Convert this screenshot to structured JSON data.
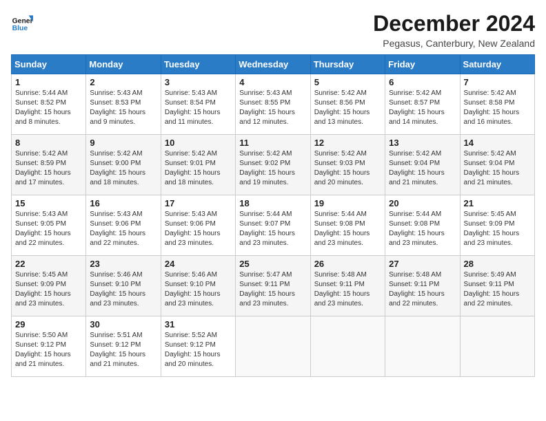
{
  "logo": {
    "line1": "General",
    "line2": "Blue"
  },
  "title": "December 2024",
  "location": "Pegasus, Canterbury, New Zealand",
  "weekdays": [
    "Sunday",
    "Monday",
    "Tuesday",
    "Wednesday",
    "Thursday",
    "Friday",
    "Saturday"
  ],
  "weeks": [
    [
      {
        "day": 1,
        "sunrise": "5:44 AM",
        "sunset": "8:52 PM",
        "daylight": "15 hours and 8 minutes."
      },
      {
        "day": 2,
        "sunrise": "5:43 AM",
        "sunset": "8:53 PM",
        "daylight": "15 hours and 9 minutes."
      },
      {
        "day": 3,
        "sunrise": "5:43 AM",
        "sunset": "8:54 PM",
        "daylight": "15 hours and 11 minutes."
      },
      {
        "day": 4,
        "sunrise": "5:43 AM",
        "sunset": "8:55 PM",
        "daylight": "15 hours and 12 minutes."
      },
      {
        "day": 5,
        "sunrise": "5:42 AM",
        "sunset": "8:56 PM",
        "daylight": "15 hours and 13 minutes."
      },
      {
        "day": 6,
        "sunrise": "5:42 AM",
        "sunset": "8:57 PM",
        "daylight": "15 hours and 14 minutes."
      },
      {
        "day": 7,
        "sunrise": "5:42 AM",
        "sunset": "8:58 PM",
        "daylight": "15 hours and 16 minutes."
      }
    ],
    [
      {
        "day": 8,
        "sunrise": "5:42 AM",
        "sunset": "8:59 PM",
        "daylight": "15 hours and 17 minutes."
      },
      {
        "day": 9,
        "sunrise": "5:42 AM",
        "sunset": "9:00 PM",
        "daylight": "15 hours and 18 minutes."
      },
      {
        "day": 10,
        "sunrise": "5:42 AM",
        "sunset": "9:01 PM",
        "daylight": "15 hours and 18 minutes."
      },
      {
        "day": 11,
        "sunrise": "5:42 AM",
        "sunset": "9:02 PM",
        "daylight": "15 hours and 19 minutes."
      },
      {
        "day": 12,
        "sunrise": "5:42 AM",
        "sunset": "9:03 PM",
        "daylight": "15 hours and 20 minutes."
      },
      {
        "day": 13,
        "sunrise": "5:42 AM",
        "sunset": "9:04 PM",
        "daylight": "15 hours and 21 minutes."
      },
      {
        "day": 14,
        "sunrise": "5:42 AM",
        "sunset": "9:04 PM",
        "daylight": "15 hours and 21 minutes."
      }
    ],
    [
      {
        "day": 15,
        "sunrise": "5:43 AM",
        "sunset": "9:05 PM",
        "daylight": "15 hours and 22 minutes."
      },
      {
        "day": 16,
        "sunrise": "5:43 AM",
        "sunset": "9:06 PM",
        "daylight": "15 hours and 22 minutes."
      },
      {
        "day": 17,
        "sunrise": "5:43 AM",
        "sunset": "9:06 PM",
        "daylight": "15 hours and 23 minutes."
      },
      {
        "day": 18,
        "sunrise": "5:44 AM",
        "sunset": "9:07 PM",
        "daylight": "15 hours and 23 minutes."
      },
      {
        "day": 19,
        "sunrise": "5:44 AM",
        "sunset": "9:08 PM",
        "daylight": "15 hours and 23 minutes."
      },
      {
        "day": 20,
        "sunrise": "5:44 AM",
        "sunset": "9:08 PM",
        "daylight": "15 hours and 23 minutes."
      },
      {
        "day": 21,
        "sunrise": "5:45 AM",
        "sunset": "9:09 PM",
        "daylight": "15 hours and 23 minutes."
      }
    ],
    [
      {
        "day": 22,
        "sunrise": "5:45 AM",
        "sunset": "9:09 PM",
        "daylight": "15 hours and 23 minutes."
      },
      {
        "day": 23,
        "sunrise": "5:46 AM",
        "sunset": "9:10 PM",
        "daylight": "15 hours and 23 minutes."
      },
      {
        "day": 24,
        "sunrise": "5:46 AM",
        "sunset": "9:10 PM",
        "daylight": "15 hours and 23 minutes."
      },
      {
        "day": 25,
        "sunrise": "5:47 AM",
        "sunset": "9:11 PM",
        "daylight": "15 hours and 23 minutes."
      },
      {
        "day": 26,
        "sunrise": "5:48 AM",
        "sunset": "9:11 PM",
        "daylight": "15 hours and 23 minutes."
      },
      {
        "day": 27,
        "sunrise": "5:48 AM",
        "sunset": "9:11 PM",
        "daylight": "15 hours and 22 minutes."
      },
      {
        "day": 28,
        "sunrise": "5:49 AM",
        "sunset": "9:11 PM",
        "daylight": "15 hours and 22 minutes."
      }
    ],
    [
      {
        "day": 29,
        "sunrise": "5:50 AM",
        "sunset": "9:12 PM",
        "daylight": "15 hours and 21 minutes."
      },
      {
        "day": 30,
        "sunrise": "5:51 AM",
        "sunset": "9:12 PM",
        "daylight": "15 hours and 21 minutes."
      },
      {
        "day": 31,
        "sunrise": "5:52 AM",
        "sunset": "9:12 PM",
        "daylight": "15 hours and 20 minutes."
      },
      null,
      null,
      null,
      null
    ]
  ]
}
